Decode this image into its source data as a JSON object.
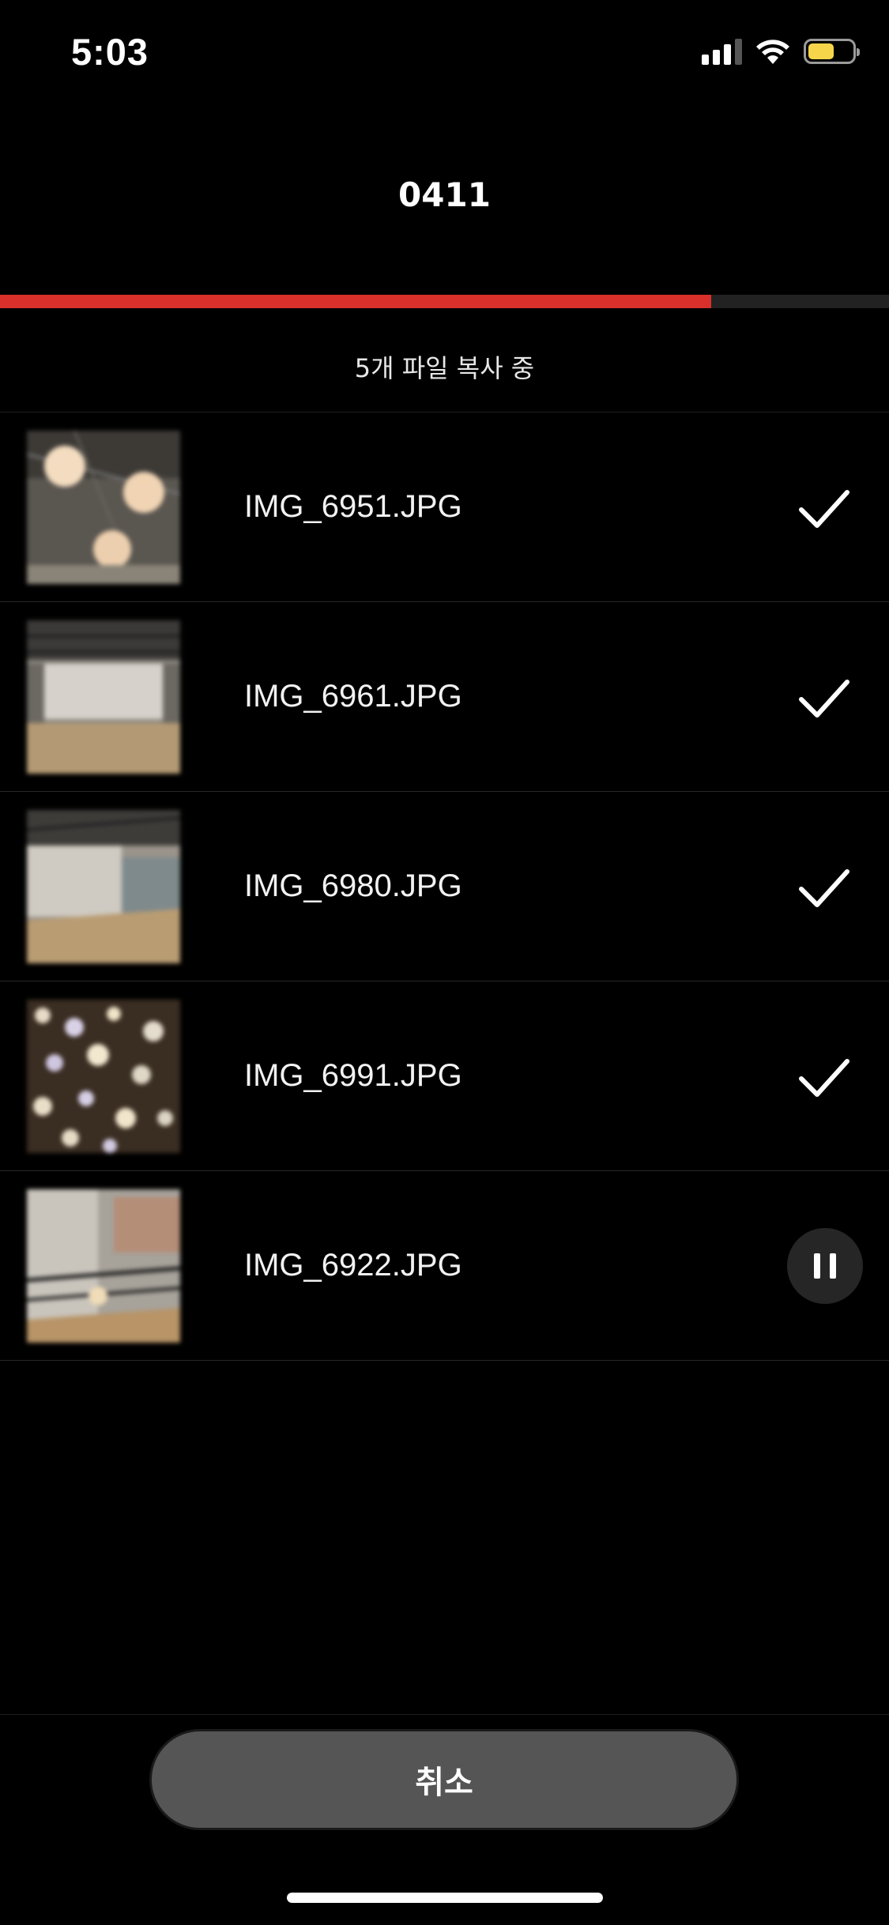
{
  "status_bar": {
    "time": "5:03",
    "battery_level": 0.6,
    "battery_color": "#F6D54A",
    "icons": [
      "signal-icon",
      "wifi-icon",
      "battery-icon"
    ]
  },
  "header": {
    "title": "0411"
  },
  "progress": {
    "value": 0.8,
    "fill_color": "#D9302C"
  },
  "status_text": "5개 파일 복사 중",
  "files": [
    {
      "name": "IMG_6951.JPG",
      "state": "done",
      "icon": "checkmark-icon"
    },
    {
      "name": "IMG_6961.JPG",
      "state": "done",
      "icon": "checkmark-icon"
    },
    {
      "name": "IMG_6980.JPG",
      "state": "done",
      "icon": "checkmark-icon"
    },
    {
      "name": "IMG_6991.JPG",
      "state": "done",
      "icon": "checkmark-icon"
    },
    {
      "name": "IMG_6922.JPG",
      "state": "in-progress",
      "icon": "pause-icon"
    }
  ],
  "footer": {
    "cancel_label": "취소"
  }
}
